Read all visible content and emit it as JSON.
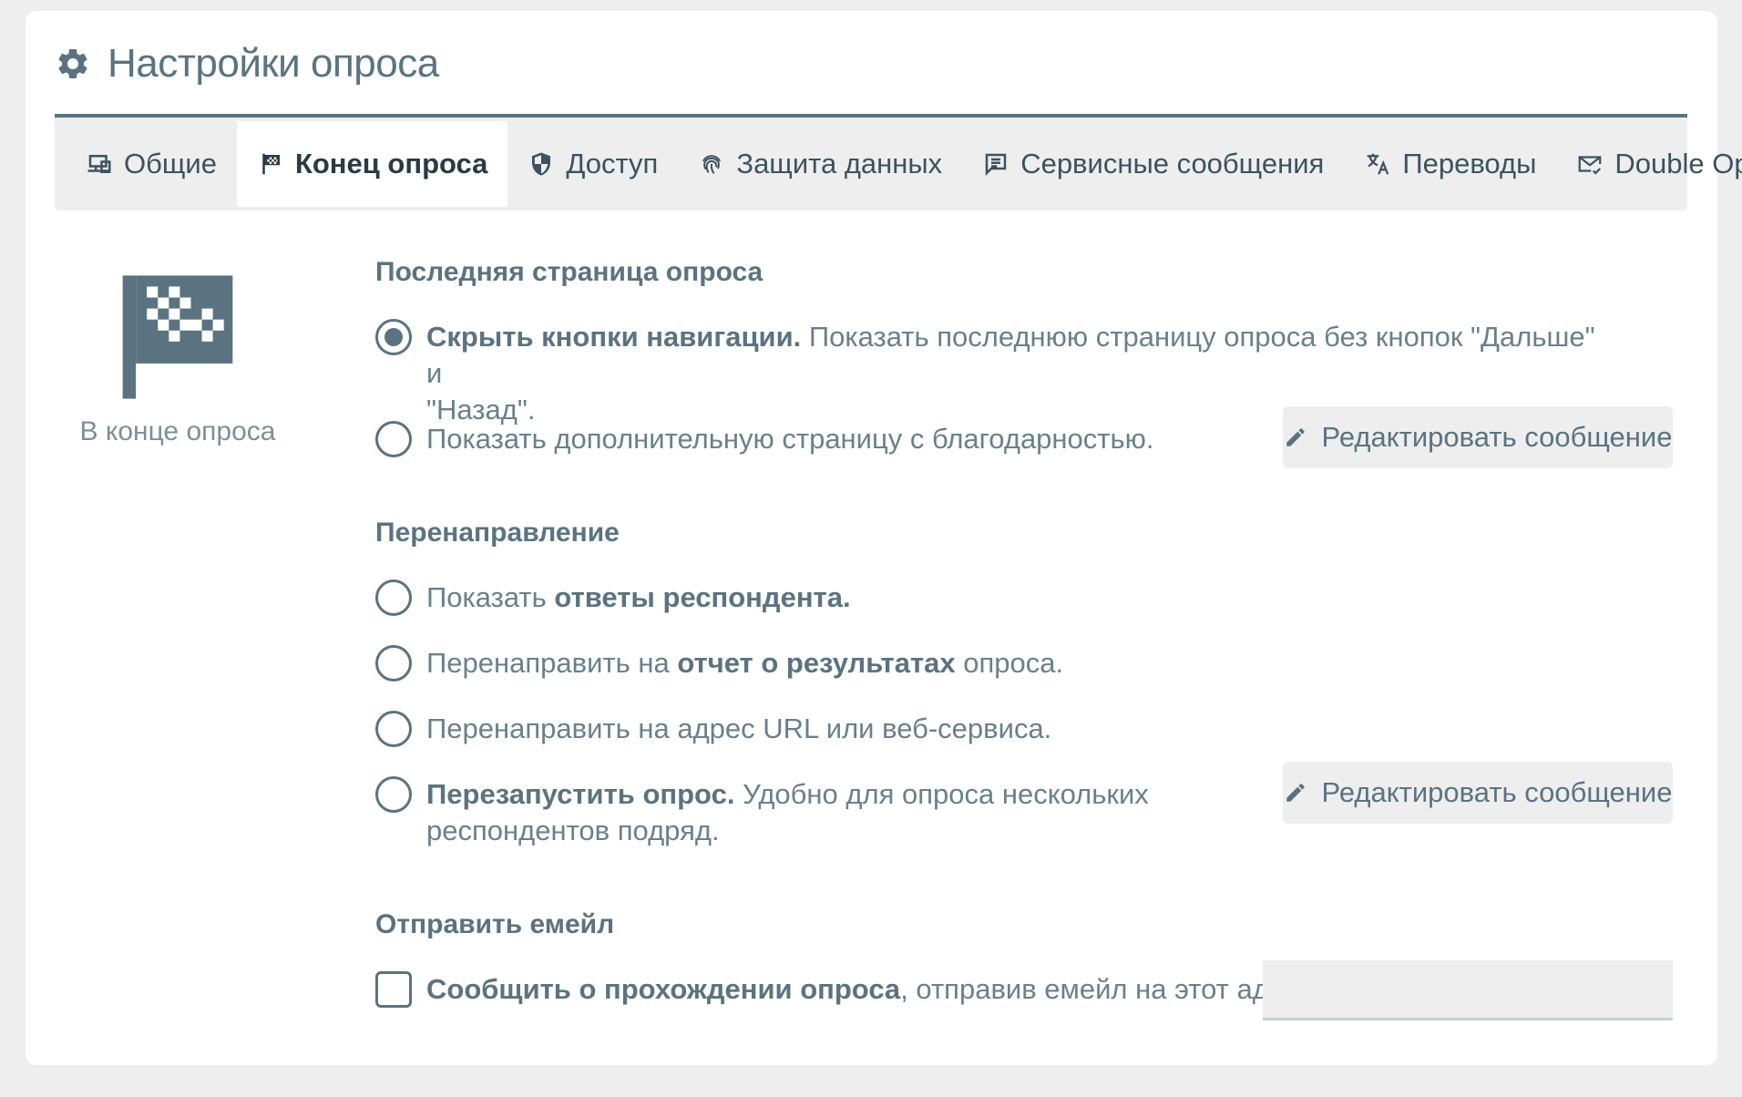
{
  "header": {
    "title": "Настройки опроса",
    "icon": "gear-icon"
  },
  "tabs": [
    {
      "label": "Общие",
      "icon": "monitor-icon",
      "active": false
    },
    {
      "label": "Конец опроса",
      "icon": "flag-icon",
      "active": true
    },
    {
      "label": "Доступ",
      "icon": "shield-icon",
      "active": false
    },
    {
      "label": "Защита данных",
      "icon": "fingerprint-icon",
      "active": false
    },
    {
      "label": "Сервисные сообщения",
      "icon": "message-icon",
      "active": false
    },
    {
      "label": "Переводы",
      "icon": "translate-icon",
      "active": false
    },
    {
      "label": "Double Opt-In",
      "icon": "mail-check-icon",
      "active": false
    }
  ],
  "sidebar": {
    "label": "В конце опроса",
    "icon": "checkered-flag-icon"
  },
  "last_page": {
    "title": "Последняя страница опроса",
    "opt_hide_nav_bold": "Скрыть кнопки навигации.",
    "opt_hide_nav_line1": " Показать последнюю страницу опроса без кнопок \"Дальше\" и",
    "opt_hide_nav_line2": "\"Назад\".",
    "opt_hide_nav_checked": true,
    "opt_thanks": "Показать дополнительную страницу с благодарностью.",
    "edit_button": "Редактировать сообщение"
  },
  "redirect": {
    "title": "Перенаправление",
    "opt_answers_pre": "Показать ",
    "opt_answers_bold": "ответы респондента.",
    "opt_report_pre": "Перенаправить на ",
    "opt_report_bold": "отчет о результатах",
    "opt_report_post": " опроса.",
    "opt_url": "Перенаправить на адрес URL или веб-сервиса.",
    "opt_restart_bold": "Перезапустить опрос.",
    "opt_restart_line1": " Удобно для опроса нескольких",
    "opt_restart_line2": "респондентов подряд.",
    "edit_button": "Редактировать сообщение"
  },
  "email": {
    "title": "Отправить емейл",
    "opt_bold": "Сообщить о прохождении опроса",
    "opt_rest": ", отправив емейл на этот адрес:",
    "input_value": "",
    "checked": false
  },
  "colors": {
    "accent": "#5b7380",
    "background": "#eeeeee",
    "card": "#ffffff"
  }
}
